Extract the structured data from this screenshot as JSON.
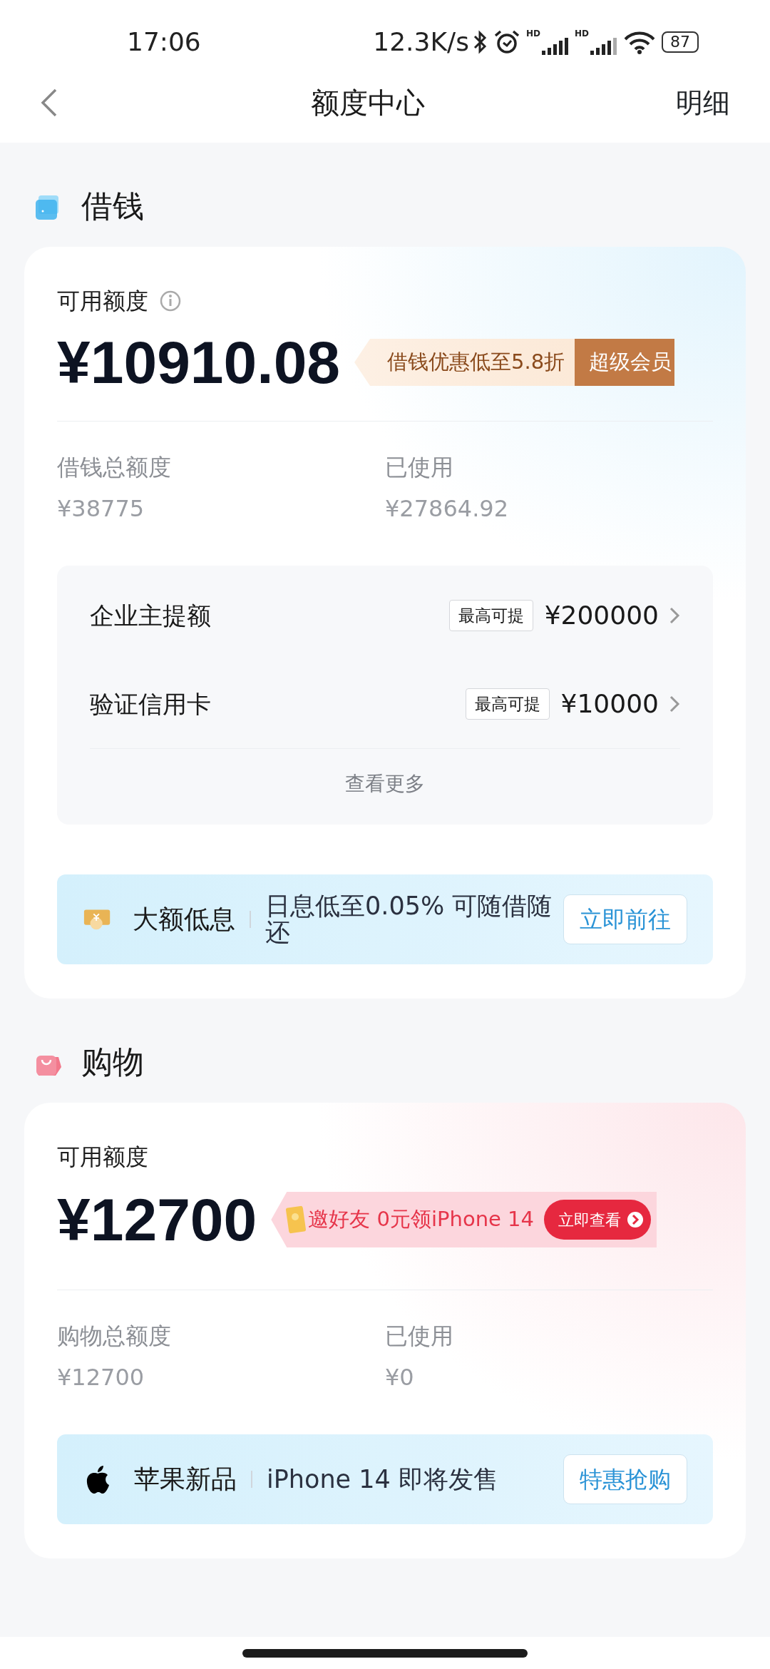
{
  "status_bar": {
    "time": "17:06",
    "net_speed": "12.3K/s",
    "signals": [
      {
        "label": "HD"
      },
      {
        "label": "HD"
      }
    ],
    "battery": "87"
  },
  "header": {
    "title": "额度中心",
    "action": "明细"
  },
  "sections": [
    {
      "kind": "loan",
      "title": "借钱",
      "available_label": "可用额度",
      "info_icon": true,
      "available": "¥10910.08",
      "promo": {
        "kind": "member",
        "text": "借钱优惠低至5.8折",
        "button": "超级会员"
      },
      "totals": [
        {
          "label": "借钱总额度",
          "value": "¥38775"
        },
        {
          "label": "已使用",
          "value": "¥27864.92"
        }
      ],
      "offers": [
        {
          "name": "企业主提额",
          "tag": "最高可提",
          "amount": "¥200000"
        },
        {
          "name": "验证信用卡",
          "tag": "最高可提",
          "amount": "¥10000"
        }
      ],
      "more": "查看更多",
      "banner": {
        "kind": "coin",
        "title": "大额低息",
        "text": "日息低至0.05% 可随借随还",
        "button": "立即前往"
      }
    },
    {
      "kind": "shop",
      "title": "购物",
      "available_label": "可用额度",
      "info_icon": false,
      "available": "¥12700",
      "promo": {
        "kind": "invite",
        "text": "邀好友 0元领iPhone 14",
        "button": "立即查看"
      },
      "totals": [
        {
          "label": "购物总额度",
          "value": "¥12700"
        },
        {
          "label": "已使用",
          "value": "¥0"
        }
      ],
      "banner": {
        "kind": "apple",
        "title": "苹果新品",
        "text": "iPhone 14 即将发售",
        "button": "特惠抢购"
      }
    }
  ]
}
